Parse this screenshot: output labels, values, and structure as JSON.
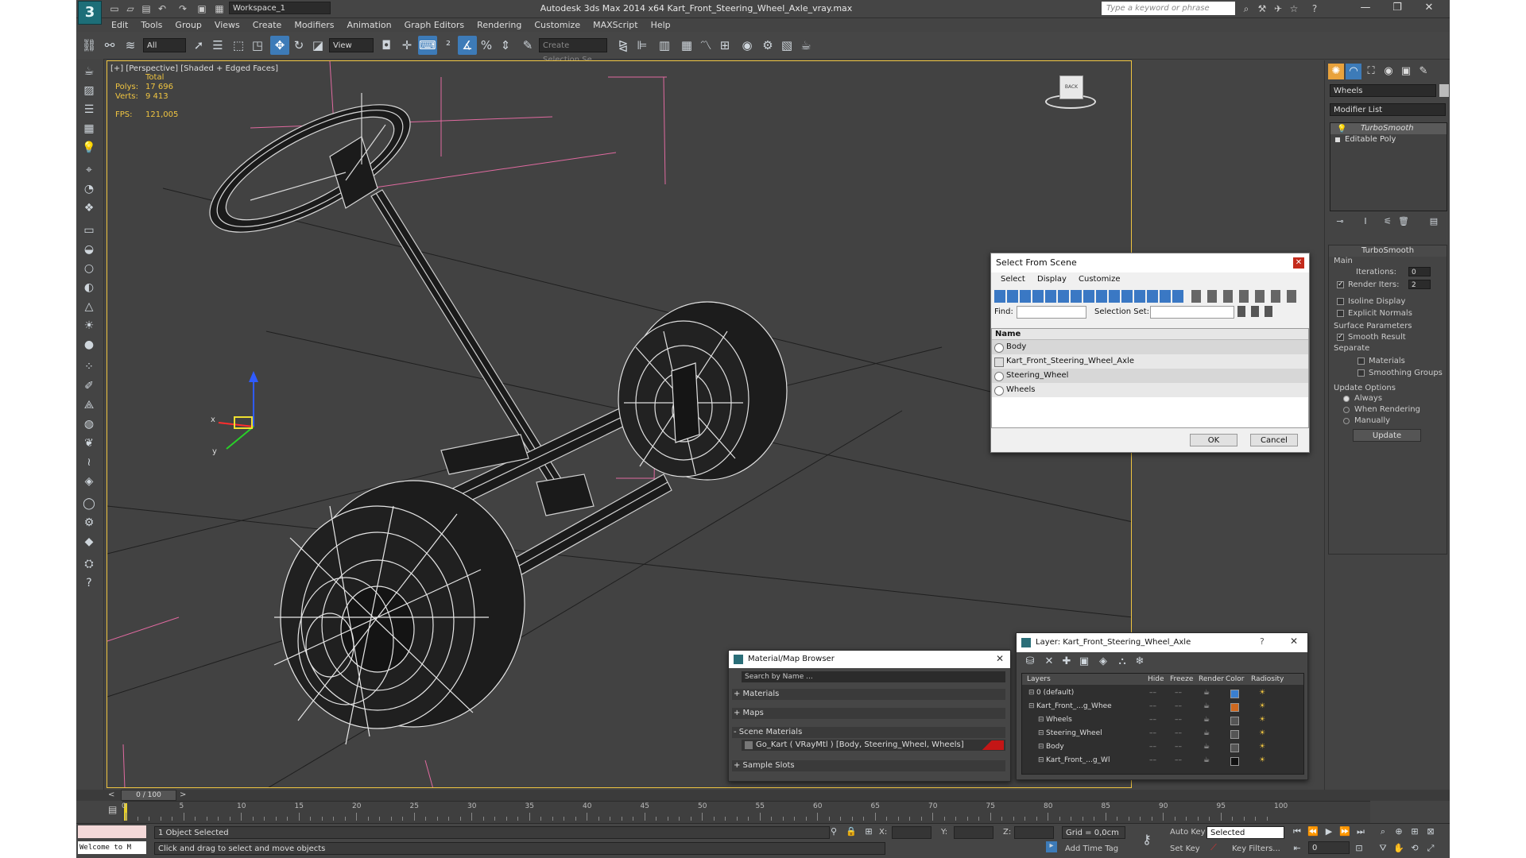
{
  "window": {
    "logo": "3",
    "title": "Autodesk 3ds Max  2014 x64     Kart_Front_Steering_Wheel_Axle_vray.max",
    "workspace": "Workspace_1",
    "search_placeholder": "Type a keyword or phrase"
  },
  "menu": [
    "Edit",
    "Tools",
    "Group",
    "Views",
    "Create",
    "Modifiers",
    "Animation",
    "Graph Editors",
    "Rendering",
    "Customize",
    "MAXScript",
    "Help"
  ],
  "toolbar": {
    "filter_value": "All",
    "refcoord_value": "View",
    "selection_set_placeholder": "Create Selection Se"
  },
  "viewport": {
    "label": "[+] [Perspective] [Shaded + Edged Faces]",
    "stats_total": "Total",
    "polys_label": "Polys:",
    "polys_value": "17 696",
    "verts_label": "Verts:",
    "verts_value": "9 413",
    "fps_label": "FPS:",
    "fps_value": "121,005",
    "viewcube_label": "BACK",
    "axis_x": "x",
    "axis_y": "y"
  },
  "command_panel": {
    "object_name": "Wheels",
    "modifier_list": "Modifier List",
    "stack": [
      "TurboSmooth",
      "Editable Poly"
    ],
    "rollout_title": "TurboSmooth",
    "main_label": "Main",
    "iterations_label": "Iterations:",
    "iterations_value": "0",
    "render_iters_label": "Render Iters:",
    "render_iters_value": "2",
    "isoline_label": "Isoline Display",
    "explicit_normals_label": "Explicit Normals",
    "surface_params_label": "Surface Parameters",
    "smooth_result_label": "Smooth Result",
    "separate_label": "Separate",
    "materials_label": "Materials",
    "smoothing_groups_label": "Smoothing Groups",
    "update_options_label": "Update Options",
    "always_label": "Always",
    "when_rendering_label": "When Rendering",
    "manually_label": "Manually",
    "update_button": "Update"
  },
  "select_dialog": {
    "title": "Select From Scene",
    "menu": [
      "Select",
      "Display",
      "Customize"
    ],
    "find_label": "Find:",
    "selection_set_label": "Selection Set:",
    "column_name": "Name",
    "items": [
      "Body",
      "Kart_Front_Steering_Wheel_Axle",
      "Steering_Wheel",
      "Wheels"
    ],
    "ok": "OK",
    "cancel": "Cancel"
  },
  "material_browser": {
    "title": "Material/Map Browser",
    "search_placeholder": "Search by Name ...",
    "groups": [
      "+ Materials",
      "+ Maps",
      "- Scene Materials",
      "+ Sample Slots"
    ],
    "scene_material": "Go_Kart  ( VRayMtl ) [Body, Steering_Wheel, Wheels]"
  },
  "layer_dialog": {
    "title": "Layer: Kart_Front_Steering_Wheel_Axle",
    "columns": [
      "Layers",
      "Hide",
      "Freeze",
      "Render",
      "Color",
      "Radiosity"
    ],
    "rows": [
      {
        "name": "0 (default)",
        "color": "#3a7fd0"
      },
      {
        "name": "Kart_Front_...g_Whee",
        "color": "#d0691f"
      },
      {
        "name": "Wheels",
        "color": "#555555"
      },
      {
        "name": "Steering_Wheel",
        "color": "#555555"
      },
      {
        "name": "Body",
        "color": "#555555"
      },
      {
        "name": "Kart_Front_...g_Wl",
        "color": "#111111"
      }
    ]
  },
  "timeline": {
    "frame_label": "0 / 100",
    "ticks": [
      "0",
      "5",
      "10",
      "15",
      "20",
      "25",
      "30",
      "35",
      "40",
      "45",
      "50",
      "55",
      "60",
      "65",
      "70",
      "75",
      "80",
      "85",
      "90",
      "95",
      "100"
    ]
  },
  "status": {
    "maxscript": "Welcome to M",
    "selected": "1 Object Selected",
    "prompt": "Click and drag to select and move objects",
    "x_label": "X:",
    "y_label": "Y:",
    "z_label": "Z:",
    "grid": "Grid = 0,0cm",
    "add_time_tag": "Add Time Tag",
    "auto_key": "Auto Key",
    "set_key": "Set Key",
    "selected_dropdown": "Selected",
    "key_filters": "Key Filters...",
    "frame_value": "0"
  }
}
